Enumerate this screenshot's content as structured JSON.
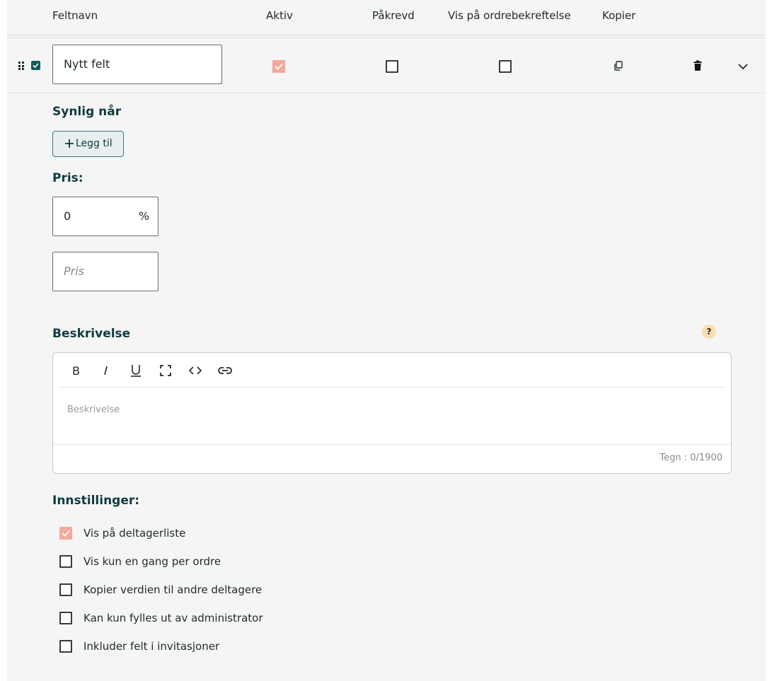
{
  "header": {
    "col_name": "Feltnavn",
    "col_active": "Aktiv",
    "col_required": "Påkrevd",
    "col_show_confirmation": "Vis på ordrebekreftelse",
    "col_copy": "Kopier"
  },
  "row": {
    "field_name_value": "Nytt felt",
    "active_checked": true,
    "required_checked": false,
    "show_on_confirmation_checked": false
  },
  "visibility": {
    "title": "Synlig når",
    "add_button_label": "Legg til"
  },
  "price": {
    "title": "Pris:",
    "percent_value": "0",
    "percent_suffix": "%",
    "price_placeholder": "Pris"
  },
  "description": {
    "title": "Beskrivelse",
    "help_label": "?",
    "placeholder": "Beskrivelse",
    "counter": "Tegn : 0/1900"
  },
  "settings": {
    "title": "Innstillinger:",
    "items": [
      {
        "label": "Vis på deltagerliste",
        "checked": true
      },
      {
        "label": "Vis kun en gang per ordre",
        "checked": false
      },
      {
        "label": "Kopier verdien til andre deltagere",
        "checked": false
      },
      {
        "label": "Kan kun fylles ut av administrator",
        "checked": false
      },
      {
        "label": "Inkluder felt i invitasjoner",
        "checked": false
      }
    ]
  },
  "colors": {
    "accent": "#0e5a5e",
    "checked_disabled": "#f4a79b",
    "panel_bg": "#f5f5f5",
    "help_bg": "#f8dfb0"
  }
}
